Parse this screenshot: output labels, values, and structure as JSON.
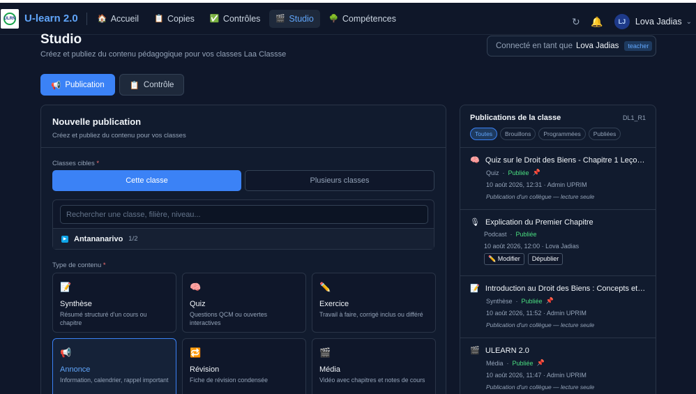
{
  "topbar": {
    "brand": "U-learn 2.0",
    "logo_text": "ULRN",
    "nav": [
      {
        "icon": "🏠",
        "label": "Accueil"
      },
      {
        "icon": "📋",
        "label": "Copies"
      },
      {
        "icon": "✅",
        "label": "Contrôles"
      },
      {
        "icon": "🎬",
        "label": "Studio"
      },
      {
        "icon": "🌳",
        "label": "Compétences"
      }
    ],
    "refresh_icon": "↻",
    "bell_icon": "🔔",
    "avatar_initials": "LJ",
    "user_name": "Lova Jadias",
    "chevron": "⌄"
  },
  "header": {
    "title": "Studio",
    "subtitle": "Créez et publiez du contenu pédagogique pour vos classes Laa Classse",
    "connected_prefix": "Connecté en tant que",
    "connected_name": "Lova Jadias",
    "role_badge": "teacher"
  },
  "tabs": [
    {
      "icon": "📢",
      "label": "Publication"
    },
    {
      "icon": "📋",
      "label": "Contrôle"
    }
  ],
  "form": {
    "title": "Nouvelle publication",
    "subtitle": "Créez et publiez du contenu pour vos classes",
    "classes_label": "Classes cibles",
    "required_mark": "*",
    "seg_single": "Cette classe",
    "seg_multi": "Plusieurs classes",
    "search_placeholder": "Rechercher une classe, filière, niveau...",
    "city_icon": "▶",
    "city_name": "Antananarivo",
    "city_count": "1/2",
    "type_label": "Type de contenu",
    "types": [
      {
        "icon": "📝",
        "name": "Synthèse",
        "desc": "Résumé structuré d'un cours ou chapitre"
      },
      {
        "icon": "🧠",
        "name": "Quiz",
        "desc": "Questions QCM ou ouvertes interactives"
      },
      {
        "icon": "✏️",
        "name": "Exercice",
        "desc": "Travail à faire, corrigé inclus ou différé"
      },
      {
        "icon": "📢",
        "name": "Annonce",
        "desc": "Information, calendrier, rappel important"
      },
      {
        "icon": "🔁",
        "name": "Révision",
        "desc": "Fiche de révision condensée"
      },
      {
        "icon": "🎬",
        "name": "Média",
        "desc": "Vidéo avec chapitres et notes de cours"
      }
    ]
  },
  "panel": {
    "title": "Publications de la classe",
    "code": "DL1_R1",
    "filters": [
      "Toutes",
      "Brouillons",
      "Programmées",
      "Publiées"
    ],
    "items": [
      {
        "icon": "🧠",
        "title": "Quiz sur le Droit des Biens - Chapitre 1 Leçon 1",
        "type": "Quiz",
        "status": "Publiée",
        "pin": "📌",
        "date": "10 août 2026, 12:31 · Admin UPRIM",
        "note": "Publication d'un collègue — lecture seule"
      },
      {
        "icon": "🎙",
        "title": "Explication du Premier Chapitre",
        "type": "Podcast",
        "status": "Publiée",
        "pin": "",
        "date": "10 août 2026, 12:00 · Lova Jadias",
        "btn_edit": "✏️ Modifier",
        "btn_unpub": "Dépublier"
      },
      {
        "icon": "📝",
        "title": "Introduction au Droit des Biens : Concepts et Principes",
        "type": "Synthèse",
        "status": "Publiée",
        "pin": "📌",
        "date": "10 août 2026, 11:52 · Admin UPRIM",
        "note": "Publication d'un collègue — lecture seule"
      },
      {
        "icon": "🎬",
        "title": "ULEARN 2.0",
        "type": "Média",
        "status": "Publiée",
        "pin": "📌",
        "date": "10 août 2026, 11:47 · Admin UPRIM",
        "note": "Publication d'un collègue — lecture seule"
      }
    ]
  }
}
